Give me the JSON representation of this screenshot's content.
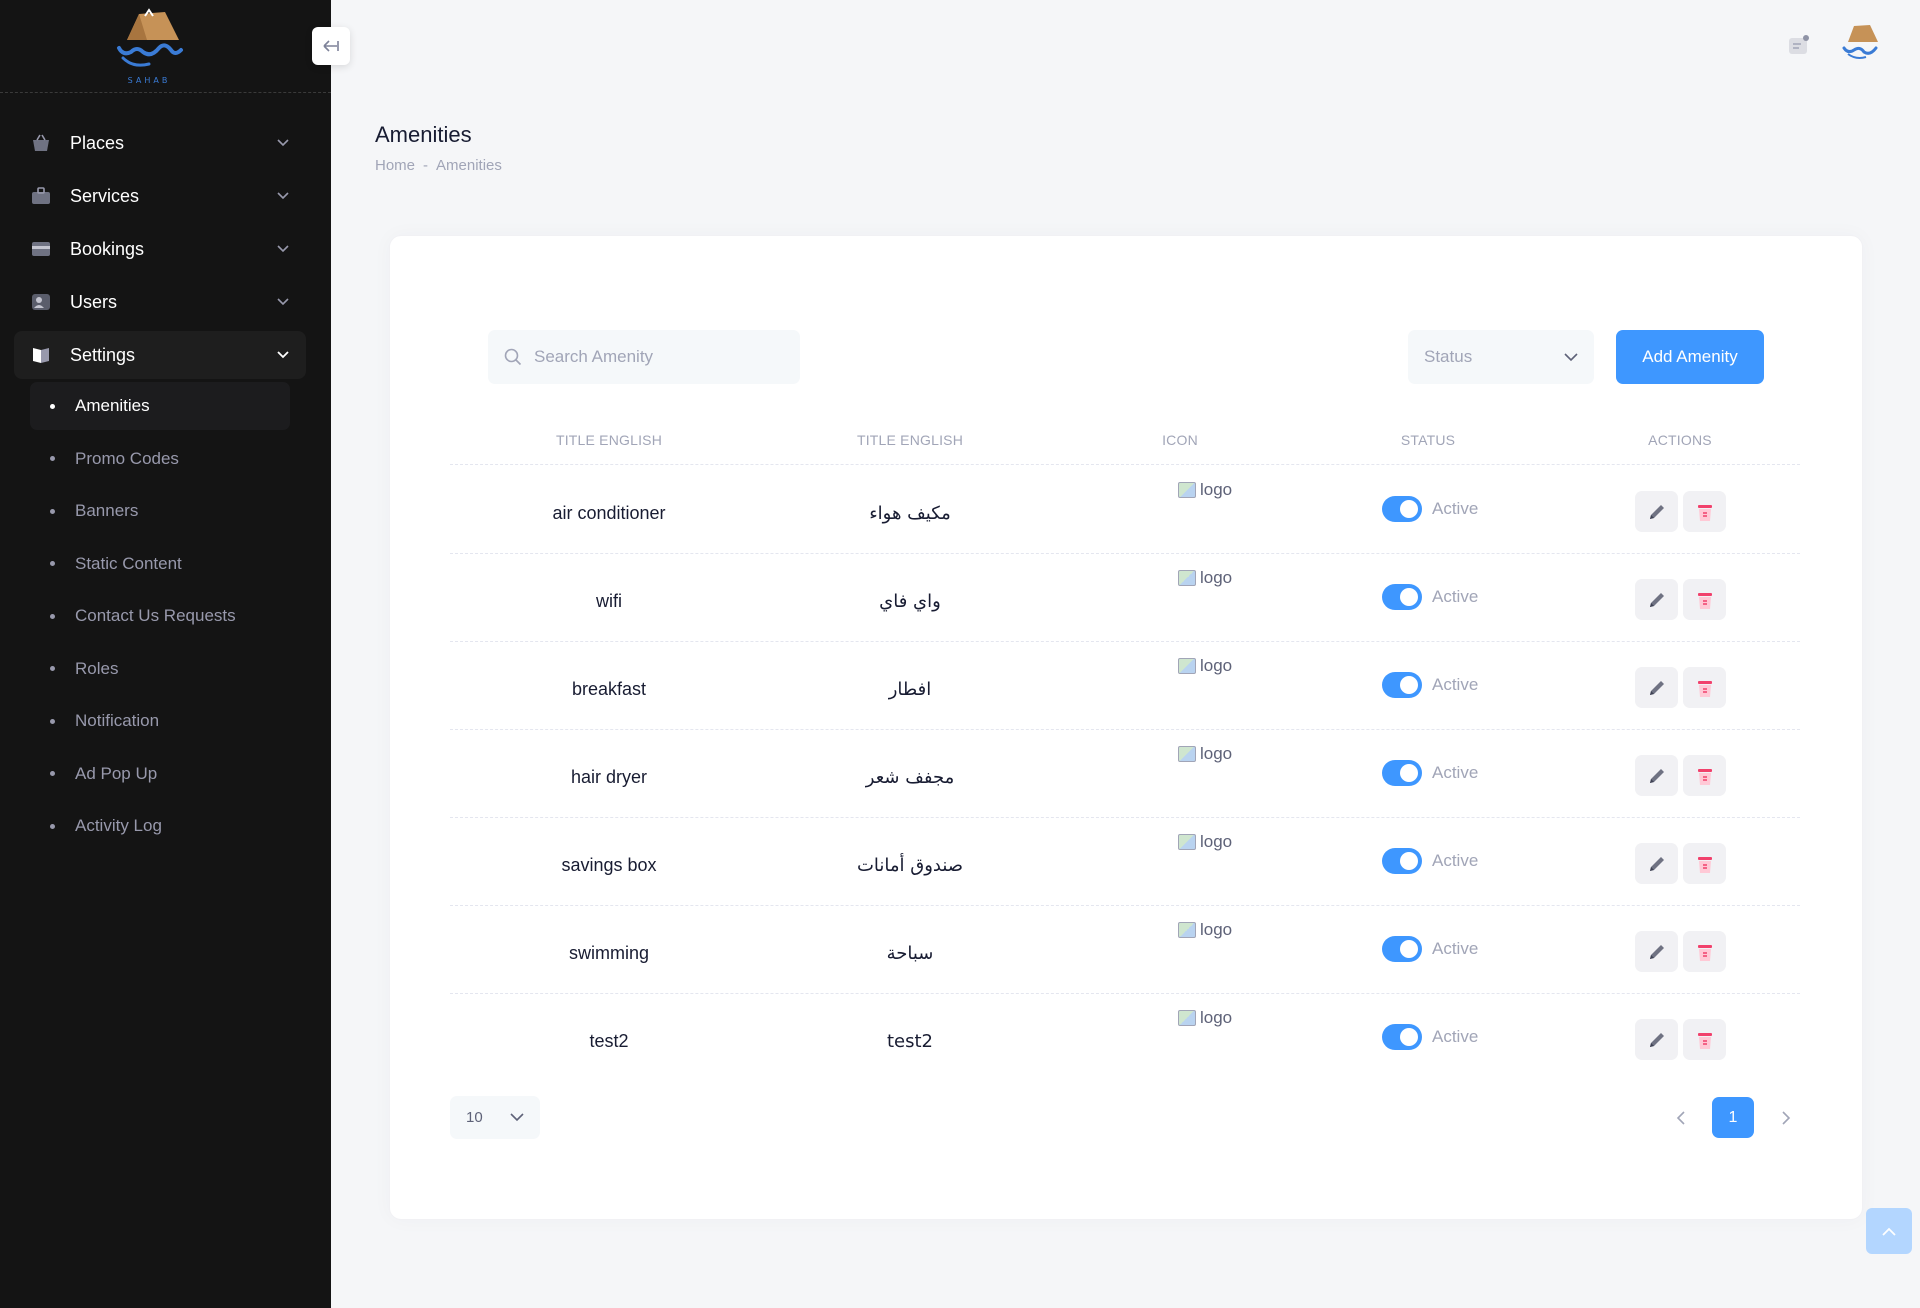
{
  "brand": {
    "logo_text": "سحاب",
    "logo_sub": "SAHAB"
  },
  "sidebar": {
    "items": [
      {
        "label": "Places",
        "icon": "basket-icon"
      },
      {
        "label": "Services",
        "icon": "briefcase-icon"
      },
      {
        "label": "Bookings",
        "icon": "card-icon"
      },
      {
        "label": "Users",
        "icon": "user-card-icon"
      },
      {
        "label": "Settings",
        "icon": "book-icon"
      }
    ],
    "sub_items": [
      {
        "label": "Amenities"
      },
      {
        "label": "Promo Codes"
      },
      {
        "label": "Banners"
      },
      {
        "label": "Static Content"
      },
      {
        "label": "Contact Us Requests"
      },
      {
        "label": "Roles"
      },
      {
        "label": "Notification"
      },
      {
        "label": "Ad Pop Up"
      },
      {
        "label": "Activity Log"
      }
    ]
  },
  "page": {
    "title": "Amenities",
    "breadcrumb": {
      "home": "Home",
      "sep": "-",
      "current": "Amenities"
    }
  },
  "toolbar": {
    "search_placeholder": "Search Amenity",
    "status_label": "Status",
    "add_label": "Add Amenity"
  },
  "table": {
    "headers": [
      "TITLE ENGLISH",
      "TITLE ENGLISH",
      "ICON",
      "STATUS",
      "ACTIONS"
    ],
    "rows": [
      {
        "title_en": "air conditioner",
        "title_ar": "مكيف هواء",
        "icon_alt": "logo",
        "status": "Active"
      },
      {
        "title_en": "wifi",
        "title_ar": "واي فاي",
        "icon_alt": "logo",
        "status": "Active"
      },
      {
        "title_en": "breakfast",
        "title_ar": "افطار",
        "icon_alt": "logo",
        "status": "Active"
      },
      {
        "title_en": "hair dryer",
        "title_ar": "مجفف شعر",
        "icon_alt": "logo",
        "status": "Active"
      },
      {
        "title_en": "savings box",
        "title_ar": "صندوق أمانات",
        "icon_alt": "logo",
        "status": "Active"
      },
      {
        "title_en": "swimming",
        "title_ar": "سباحة",
        "icon_alt": "logo",
        "status": "Active"
      },
      {
        "title_en": "test2",
        "title_ar": "test2",
        "icon_alt": "logo",
        "status": "Active"
      }
    ]
  },
  "pagination": {
    "page_size": "10",
    "current_page": "1"
  },
  "colors": {
    "primary": "#3e97ff",
    "sidebar_bg": "#141414",
    "danger": "#f1416c"
  }
}
